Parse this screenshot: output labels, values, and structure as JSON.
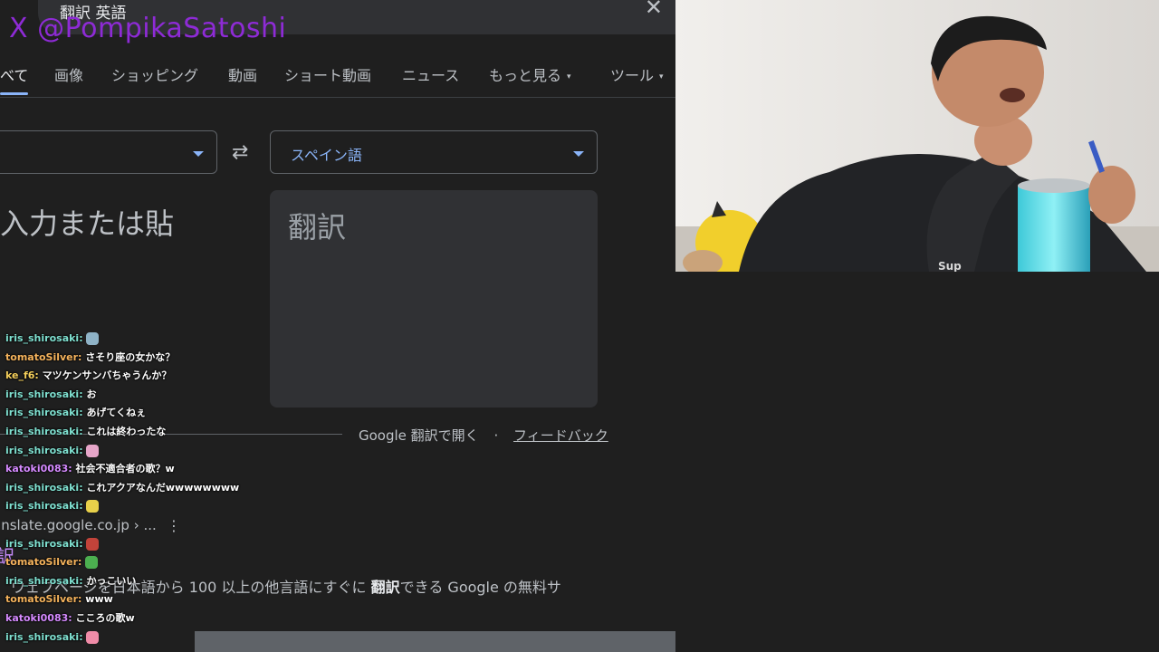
{
  "search_bar": {
    "query": "翻訳 英語",
    "close_glyph": "✕"
  },
  "watermark": "X @PompikaSatoshi",
  "tabs": [
    {
      "label": "べて",
      "active": true
    },
    {
      "label": "画像"
    },
    {
      "label": "ショッピング"
    },
    {
      "label": "動画"
    },
    {
      "label": "ショート動画"
    },
    {
      "label": "ニュース"
    },
    {
      "label": "もっと見る",
      "caret": "▾"
    },
    {
      "label": "ツール",
      "caret": "▾"
    }
  ],
  "translator": {
    "source_lang": "",
    "target_lang": "スペイン語",
    "swap_glyph": "⇄",
    "source_placeholder": "入力または貼",
    "target_placeholder": "翻訳"
  },
  "footer": {
    "open_link": "Google 翻訳で開く",
    "separator": "·",
    "feedback": "フィードバック"
  },
  "result": {
    "url": "anslate.google.co.jp › ...",
    "menu_glyph": "⋮",
    "title": "訳",
    "snippet_pre": "ウェブページを日本語から 100 以上の他言語にすぐに ",
    "snippet_bold": "翻訳",
    "snippet_post": "できる Google の無料サ"
  },
  "chat": [
    {
      "user": "iris_shirosaki",
      "text": "",
      "emote_color": "#8fb3c7",
      "user_color": "#7fe0d0"
    },
    {
      "user": "tomatoSilver",
      "text": "さそり座の女かな？",
      "user_color": "#f5b35c"
    },
    {
      "user": "ke_f6",
      "text": "マツケンサンバちゃうんか？",
      "user_color": "#f5d05c"
    },
    {
      "user": "iris_shirosaki",
      "text": "お",
      "user_color": "#7fe0d0"
    },
    {
      "user": "iris_shirosaki",
      "text": "あげてくねぇ",
      "user_color": "#7fe0d0"
    },
    {
      "user": "iris_shirosaki",
      "text": "これは終わったな",
      "user_color": "#7fe0d0"
    },
    {
      "user": "iris_shirosaki",
      "text": "",
      "emote_color": "#e6a6c9",
      "user_color": "#7fe0d0"
    },
    {
      "user": "katoki0083",
      "text": "社会不適合者の歌？w",
      "user_color": "#d58aff"
    },
    {
      "user": "iris_shirosaki",
      "text": "これアクアなんだwwwwwwww",
      "user_color": "#7fe0d0"
    },
    {
      "user": "iris_shirosaki",
      "text": "",
      "emote_color": "#e8d04a",
      "user_color": "#7fe0d0"
    },
    {
      "user": "",
      "text": "",
      "user_color": "#7fe0d0"
    },
    {
      "user": "iris_shirosaki",
      "text": "",
      "emote_color": "#c2433a",
      "user_color": "#7fe0d0"
    },
    {
      "user": "tomatoSilver",
      "text": "",
      "emote_color": "#4caf50",
      "user_color": "#f5b35c"
    },
    {
      "user": "iris_shirosaki",
      "text": "かっこいい",
      "user_color": "#7fe0d0"
    },
    {
      "user": "tomatoSilver",
      "text": "www",
      "user_color": "#f5b35c"
    },
    {
      "user": "katoki0083",
      "text": "こころの歌w",
      "user_color": "#d58aff"
    },
    {
      "user": "iris_shirosaki",
      "text": "",
      "emote_color": "#f08ca8",
      "user_color": "#7fe0d0"
    }
  ]
}
